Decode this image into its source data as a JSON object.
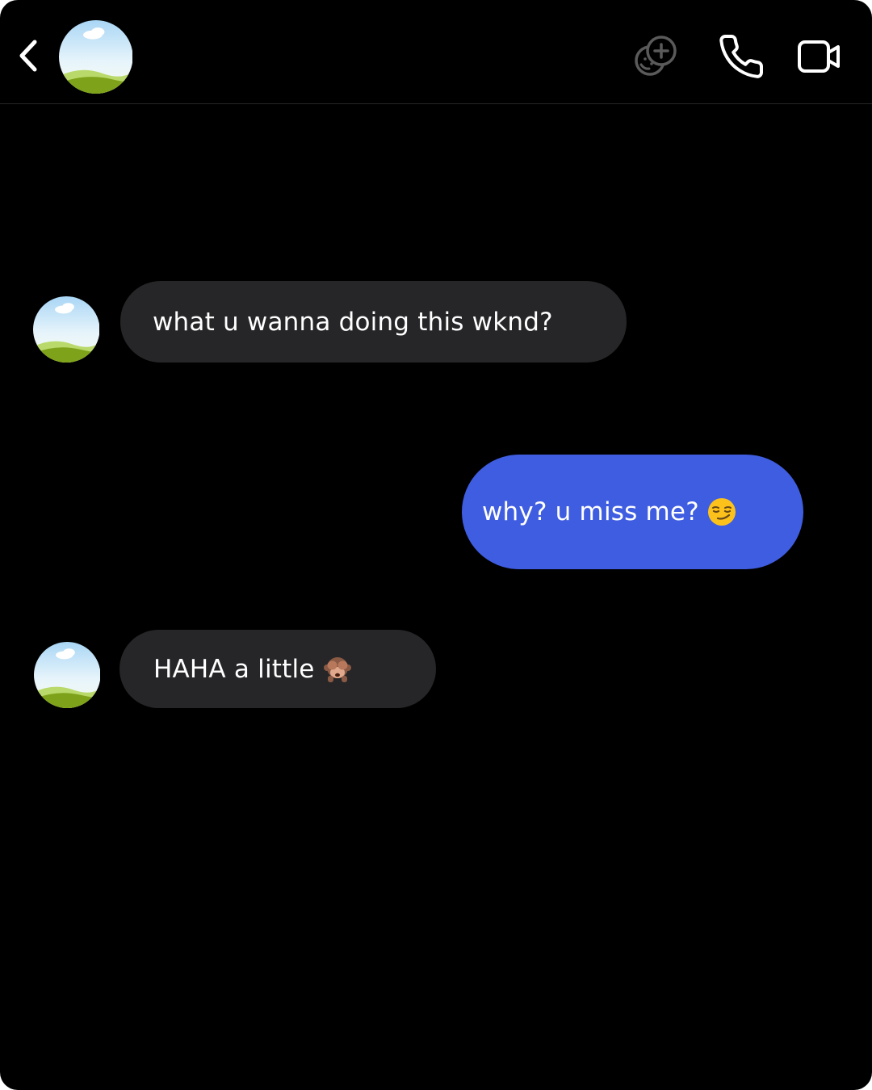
{
  "header": {
    "back_icon": "chevron-left-icon",
    "avatar": "default-landscape-avatar",
    "actions": [
      {
        "name": "effects",
        "icon": "face-sparkle-icon"
      },
      {
        "name": "voice-call",
        "icon": "phone-icon"
      },
      {
        "name": "video-call",
        "icon": "video-camera-icon"
      }
    ]
  },
  "messages": [
    {
      "direction": "incoming",
      "text": "what u wanna doing this wknd?",
      "emoji": ""
    },
    {
      "direction": "outgoing",
      "text": "why? u miss me?",
      "emoji": "smirking-face-icon"
    },
    {
      "direction": "incoming",
      "text": "HAHA a little",
      "emoji": "see-no-evil-monkey-icon"
    }
  ],
  "colors": {
    "background": "#000000",
    "incoming_bubble": "#262628",
    "outgoing_bubble": "#3f5de0",
    "text": "#ffffff",
    "header_divider": "#262626"
  }
}
